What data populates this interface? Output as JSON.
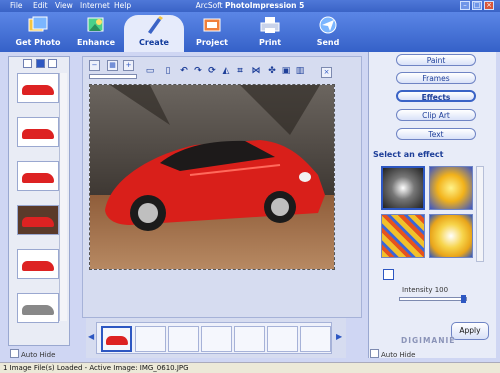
{
  "menu": [
    "File",
    "Edit",
    "View",
    "Internet",
    "Help"
  ],
  "window": {
    "title_prefix": "ArcSoft",
    "title_name": "PhotoImpression 5"
  },
  "tools": [
    {
      "label": "Get Photo",
      "icon": "get-photo-icon"
    },
    {
      "label": "Enhance",
      "icon": "enhance-icon"
    },
    {
      "label": "Create",
      "icon": "create-icon",
      "active": true
    },
    {
      "label": "Project",
      "icon": "project-icon"
    },
    {
      "label": "Print",
      "icon": "print-icon"
    },
    {
      "label": "Send",
      "icon": "send-icon"
    }
  ],
  "left_panel": {
    "auto_hide": "Auto Hide"
  },
  "right_panel": {
    "buttons": [
      "Paint",
      "Frames",
      "Effects",
      "Clip Art",
      "Text"
    ],
    "active": "Effects",
    "select_title": "Select an effect",
    "intensity_label": "Intensity 100",
    "intensity_value": 100,
    "apply": "Apply",
    "auto_hide": "Auto Hide",
    "brand": "DIGIMANIE"
  },
  "status": "1 Image File(s) Loaded - Active Image: IMG_0610.JPG",
  "colors": {
    "titlebar": "#3a63c6",
    "accent": "#2d57c2",
    "car_red": "#d22222"
  }
}
